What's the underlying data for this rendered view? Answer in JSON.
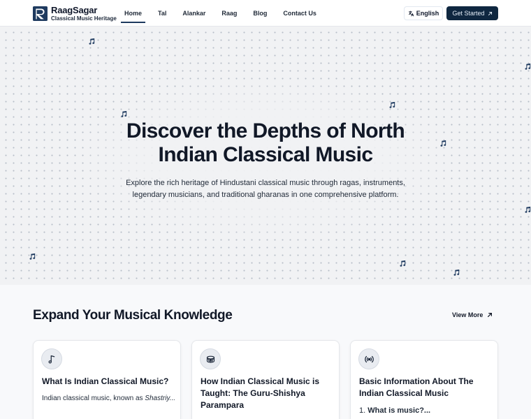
{
  "header": {
    "brand": "RaagSagar",
    "tagline": "Classical Music Heritage",
    "nav": [
      {
        "label": "Home",
        "active": true
      },
      {
        "label": "Tal",
        "active": false
      },
      {
        "label": "Alankar",
        "active": false
      },
      {
        "label": "Raag",
        "active": false
      },
      {
        "label": "Blog",
        "active": false
      },
      {
        "label": "Contact Us",
        "active": false
      }
    ],
    "language_label": "English",
    "cta_label": "Get Started"
  },
  "hero": {
    "title_line1": "Discover the Depths of North",
    "title_line2": "Indian Classical Music",
    "subtitle_line1": "Explore the rich heritage of Hindustani classical music through ragas, instruments,",
    "subtitle_line2": "legendary musicians, and traditional gharanas in one comprehensive platform."
  },
  "knowledge": {
    "title": "Expand Your Musical Knowledge",
    "view_more_label": "View More",
    "cards": [
      {
        "icon": "music-note-icon",
        "title": "What Is Indian Classical Music?",
        "excerpt_prefix": "Indian classical music, known as ",
        "excerpt_italic": "Shastriy..."
      },
      {
        "icon": "drum-icon",
        "title": "How Indian Classical Music is Taught: The Guru-Shishya Parampara"
      },
      {
        "icon": "broadcast-icon",
        "title": "Basic Information About The Indian Classical Music",
        "excerpt_number": "1. ",
        "excerpt_bold": "What is music?..."
      }
    ]
  },
  "colors": {
    "primary_dark": "#0f2740",
    "accent_underline": "#1e3a5f",
    "note_color": "#1e3a5f",
    "hero_bg": "#f1f2f4"
  }
}
